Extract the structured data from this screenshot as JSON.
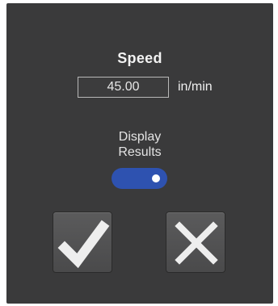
{
  "dialog": {
    "title": "Speed",
    "speed_value": "45.00",
    "speed_unit": "in/min",
    "toggle": {
      "label_line1": "Display",
      "label_line2": "Results",
      "checked": true,
      "accent": "#2e52b0"
    },
    "buttons": {
      "confirm_icon": "checkmark-icon",
      "cancel_icon": "x-icon"
    },
    "colors": {
      "panel": "#3a3a3b",
      "button": "#545455",
      "text": "#f2f2f2"
    }
  }
}
